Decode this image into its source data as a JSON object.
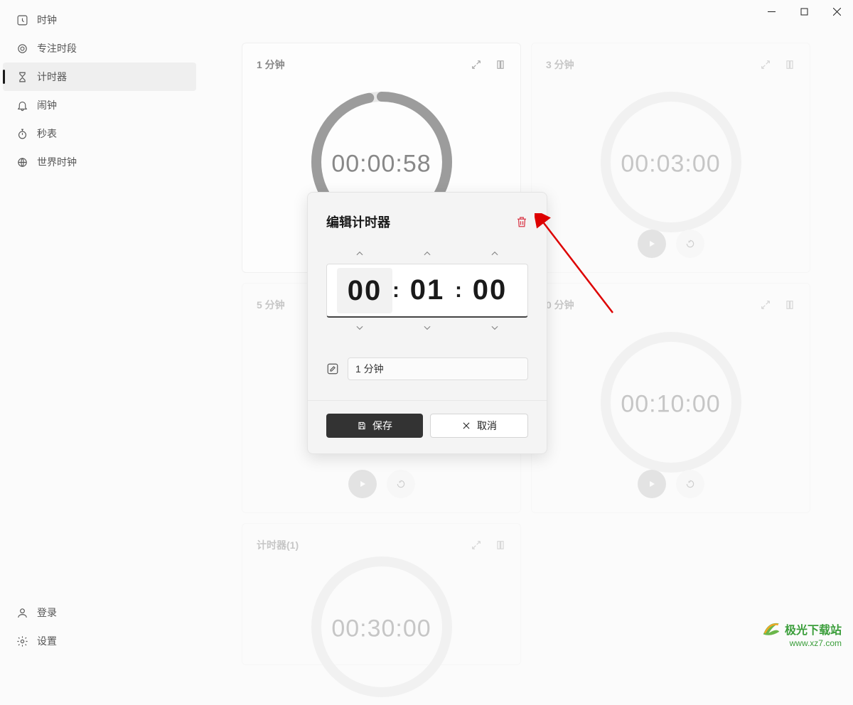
{
  "sidebar": {
    "items": [
      {
        "label": "时钟",
        "icon": "clock-square"
      },
      {
        "label": "专注时段",
        "icon": "target"
      },
      {
        "label": "计时器",
        "icon": "hourglass"
      },
      {
        "label": "闹钟",
        "icon": "bell"
      },
      {
        "label": "秒表",
        "icon": "stopwatch"
      },
      {
        "label": "世界时钟",
        "icon": "globe"
      }
    ],
    "bottom": {
      "login": "登录",
      "settings": "设置"
    }
  },
  "timers": [
    {
      "name": "1 分钟",
      "time": "00:00:58",
      "progress": 0.97
    },
    {
      "name": "3 分钟",
      "time": "00:03:00",
      "progress": 0
    },
    {
      "name": "5 分钟",
      "time": "",
      "progress": 0
    },
    {
      "name": "0 分钟",
      "time": "00:10:00",
      "progress": 0
    },
    {
      "name": "计时器(1)",
      "time": "00:30:00",
      "progress": 0
    }
  ],
  "dialog": {
    "title": "编辑计时器",
    "hours": "00",
    "minutes": "01",
    "seconds": "00",
    "name_value": "1 分钟",
    "save": "保存",
    "cancel": "取消"
  },
  "watermark": {
    "text": "极光下载站",
    "url": "www.xz7.com"
  }
}
